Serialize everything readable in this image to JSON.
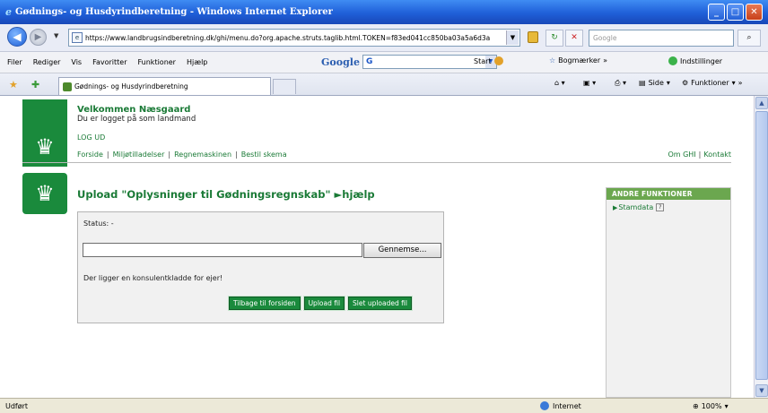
{
  "window": {
    "title": "Gødnings- og Husdyrindberetning - Windows Internet Explorer"
  },
  "address": {
    "url": "https://www.landbrugsindberetning.dk/ghi/menu.do?org.apache.struts.taglib.html.TOKEN=f83ed041cc850ba03a5a6d3a",
    "search_placeholder": "Google"
  },
  "menu": {
    "items": [
      "Filer",
      "Rediger",
      "Vis",
      "Favoritter",
      "Funktioner",
      "Hjælp"
    ]
  },
  "google_toolbar": {
    "label": "Google",
    "box_value": "G",
    "start": "Start",
    "bookmarks": "Bogmærker",
    "more": "»",
    "settings": "Indstillinger"
  },
  "tab": {
    "title": "Gødnings- og Husdyrindberetning"
  },
  "commandbar": {
    "page": "Side",
    "tools": "Funktioner",
    "more": "»"
  },
  "page": {
    "welcome": "Velkommen Næsgaard",
    "logged_in": "Du er logget på som landmand",
    "logout": "LOG UD",
    "nav": [
      "Forside",
      "Miljøtilladelser",
      "Regnemaskinen",
      "Bestil skema"
    ],
    "right_nav": [
      "Om GHI",
      "Kontakt"
    ],
    "heading": "Upload \"Oplysninger til Gødningsregnskab\"",
    "help": "►hjælp",
    "status_label": "Status: -",
    "browse_button": "Gennemse...",
    "draft_notice": "Der ligger en konsulentkladde for ejer!",
    "buttons": [
      "Tilbage til forsiden",
      "Upload fil",
      "Slet uploaded fil"
    ],
    "side_header": "ANDRE FUNKTIONER",
    "side_items": [
      "Stamdata"
    ]
  },
  "statusbar": {
    "left": "Udført",
    "zone": "Internet",
    "zoom": "100%"
  }
}
